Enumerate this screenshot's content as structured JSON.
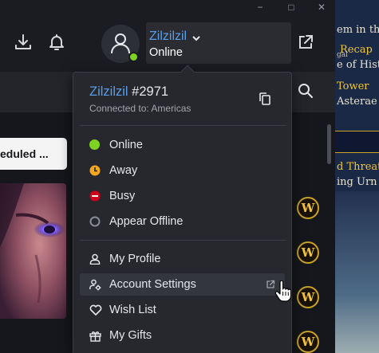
{
  "header": {
    "username": "Zilzilzil",
    "status": "Online"
  },
  "dropdown": {
    "display_name": "Zilzilzil",
    "battletag_number": " #2971",
    "connected_to": "Connected to: Americas",
    "status_options": [
      {
        "label": "Online",
        "color": "#7ed321"
      },
      {
        "label": "Away",
        "color": "#f5a623"
      },
      {
        "label": "Busy",
        "color": "#d0021b"
      },
      {
        "label": "Appear Offline",
        "color": "#8a8c93"
      }
    ],
    "menu_items": [
      {
        "label": "My Profile",
        "icon": "person-icon"
      },
      {
        "label": "Account Settings",
        "icon": "account-gear-icon"
      },
      {
        "label": "Wish List",
        "icon": "heart-icon"
      },
      {
        "label": "My Gifts",
        "icon": "gift-icon"
      }
    ]
  },
  "background": {
    "notification_pill": "eduled ...",
    "game_badge": "W",
    "game_panel_lines": [
      "em in th",
      "Recap",
      "gal",
      "e of Hist",
      "Tower",
      "Asterae",
      "d Threat",
      "ing Urn"
    ]
  },
  "colors": {
    "accent_blue": "#5a9de8",
    "online": "#7ed321",
    "away": "#f5a623",
    "busy": "#d0021b",
    "offline": "#8a8c93",
    "gold": "#c9a227"
  }
}
